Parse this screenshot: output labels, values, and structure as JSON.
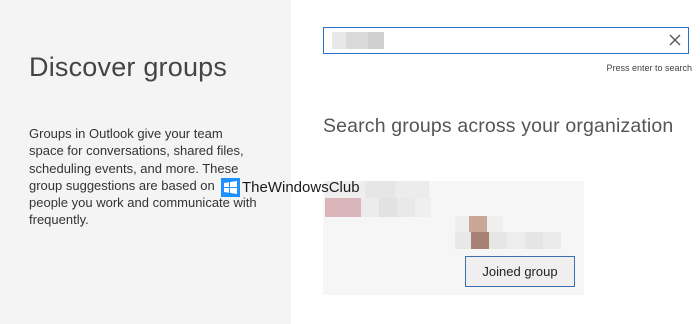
{
  "left": {
    "title": "Discover groups",
    "description": "Groups in Outlook give your team space for conversations, shared files, scheduling events, and more. These group suggestions are based on people you work and communicate with frequently."
  },
  "search": {
    "query": "",
    "query_redacted": true,
    "hint": "Press enter to search",
    "title": "Search groups across your organization",
    "clear_icon": "close-icon"
  },
  "result_card": {
    "group_name_redacted": true,
    "members_redacted": true,
    "button_label": "Joined group"
  },
  "watermark": {
    "text": "TheWindowsClub",
    "logo_color": "#1e90ff"
  },
  "colors": {
    "accent": "#2b70c4",
    "left_pane_bg": "#f4f4f4",
    "card_bg": "#f6f6f6"
  }
}
